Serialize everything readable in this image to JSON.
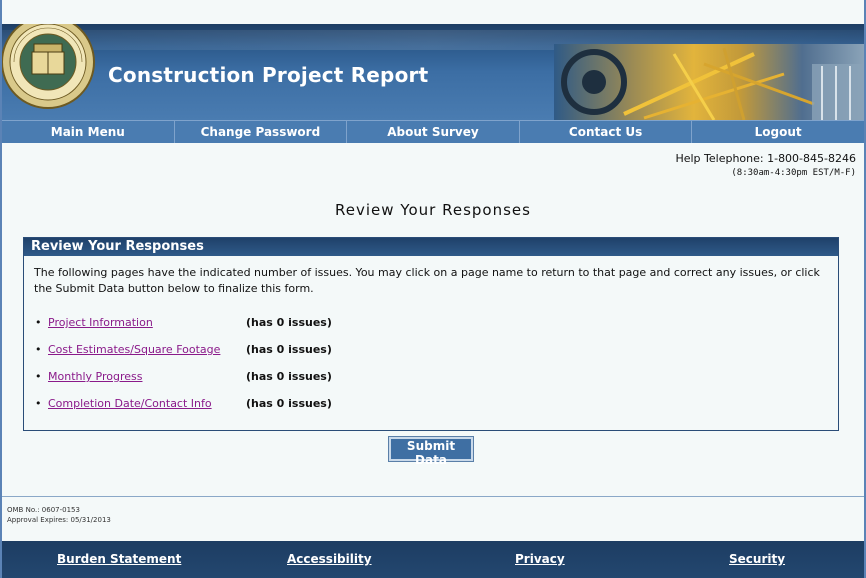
{
  "header": {
    "title": "Construction Project Report",
    "seal_label": "U.S. DEPARTMENT OF COMMERCE · BUREAU OF THE CENSUS"
  },
  "nav": {
    "items": [
      "Main Menu",
      "Change Password",
      "About Survey",
      "Contact Us",
      "Logout"
    ]
  },
  "help": {
    "phone": "Help Telephone: 1-800-845-8246",
    "hours": "(8:30am-4:30pm EST/M-F)"
  },
  "main": {
    "heading": "Review Your Responses",
    "panel": {
      "title": "Review Your Responses",
      "intro": "The following pages have the indicated number of issues. You may click on a page name to return to that page and correct any issues, or click the Submit Data button below to finalize this form.",
      "items": [
        {
          "label": "Project Information",
          "status": "(has 0 issues)"
        },
        {
          "label": "Cost Estimates/Square Footage",
          "status": "(has 0 issues)"
        },
        {
          "label": "Monthly Progress",
          "status": "(has 0 issues)"
        },
        {
          "label": "Completion Date/Contact Info",
          "status": "(has 0 issues)"
        }
      ]
    },
    "submit_label": "Submit Data"
  },
  "omb": {
    "number": "OMB No.: 0607-0153",
    "expires": "Approval Expires: 05/31/2013"
  },
  "footer": {
    "links": [
      "Burden Statement",
      "Accessibility",
      "Privacy",
      "Security"
    ]
  },
  "colors": {
    "banner": "#2c5a8c",
    "nav": "#4a7cb1",
    "link": "#8a1a8a",
    "page_bg": "#f4f9f9"
  }
}
